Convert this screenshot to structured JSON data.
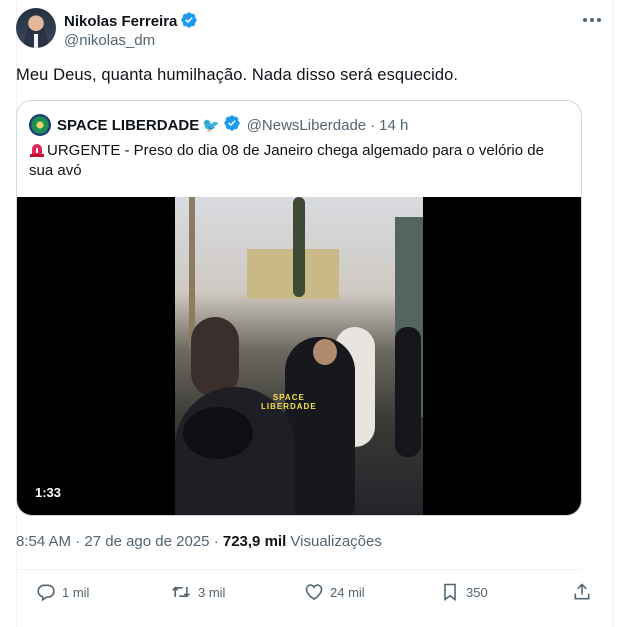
{
  "author": {
    "name": "Nikolas Ferreira",
    "handle": "@nikolas_dm"
  },
  "tweet_text": "Meu Deus, quanta humilhação. Nada disso será esquecido.",
  "quote": {
    "name": "SPACE LIBERDADE",
    "bird": "🐦",
    "handle": "@NewsLiberdade",
    "dot": "·",
    "time": "14 h",
    "text": "URGENTE - Preso do dia 08 de Janeiro chega algemado para o velório de sua avó",
    "video_time": "1:33",
    "watermark_line1": "SPACE",
    "watermark_line2": "LIBERDADE"
  },
  "meta": {
    "time": "8:54 AM",
    "sep1": "·",
    "date": "27 de ago de 2025",
    "sep2": "·",
    "views_count": "723,9 mil",
    "views_label": "Visualizações"
  },
  "actions": {
    "replies": "1 mil",
    "retweets": "3 mil",
    "likes": "24 mil",
    "bookmarks": "350"
  },
  "colors": {
    "verified": "#1d9bf0",
    "muted": "#536471",
    "text": "#0f1419",
    "border": "#cfd9de"
  }
}
